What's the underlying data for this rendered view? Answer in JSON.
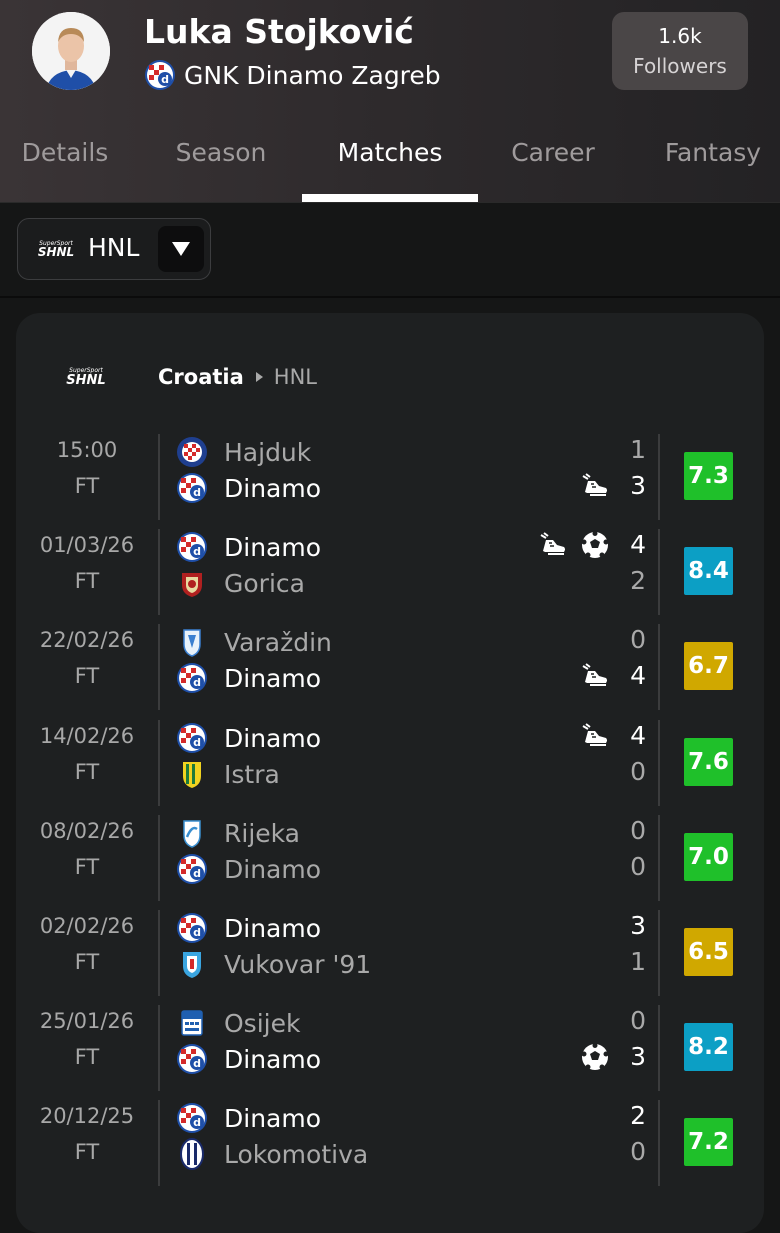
{
  "player": {
    "name": "Luka Stojković",
    "club": "GNK Dinamo Zagreb",
    "followers_count": "1.6k",
    "followers_label": "Followers"
  },
  "tabs": [
    {
      "label": "Details",
      "active": false
    },
    {
      "label": "Season",
      "active": false
    },
    {
      "label": "Matches",
      "active": true
    },
    {
      "label": "Career",
      "active": false
    },
    {
      "label": "Fantasy",
      "active": false
    }
  ],
  "league_select": {
    "label": "HNL",
    "logo_text": "SHNL",
    "logo_small": "SuperSport"
  },
  "breadcrumb": {
    "country": "Croatia",
    "league": "HNL"
  },
  "colors": {
    "rating_green": "#1fc02a",
    "rating_blue": "#0c9fc5",
    "rating_yellow": "#d0a800",
    "dinamo_blue": "#1f4fa8"
  },
  "matches": [
    {
      "date": "15:00",
      "status": "FT",
      "home": {
        "name": "Hajduk",
        "badge": "hajduk-badge",
        "score": "1",
        "dinamo": false,
        "events": []
      },
      "away": {
        "name": "Dinamo",
        "badge": "dinamo-badge",
        "score": "3",
        "dinamo": true,
        "events": [
          "assist-icon"
        ]
      },
      "rating": "7.3",
      "rating_color": "green"
    },
    {
      "date": "01/03/26",
      "status": "FT",
      "home": {
        "name": "Dinamo",
        "badge": "dinamo-badge",
        "score": "4",
        "dinamo": true,
        "events": [
          "assist-icon",
          "goal-icon"
        ]
      },
      "away": {
        "name": "Gorica",
        "badge": "gorica-badge",
        "score": "2",
        "dinamo": false,
        "events": []
      },
      "rating": "8.4",
      "rating_color": "blue"
    },
    {
      "date": "22/02/26",
      "status": "FT",
      "home": {
        "name": "Varaždin",
        "badge": "varazdin-badge",
        "score": "0",
        "dinamo": false,
        "events": []
      },
      "away": {
        "name": "Dinamo",
        "badge": "dinamo-badge",
        "score": "4",
        "dinamo": true,
        "events": [
          "assist-icon"
        ]
      },
      "rating": "6.7",
      "rating_color": "yellow"
    },
    {
      "date": "14/02/26",
      "status": "FT",
      "home": {
        "name": "Dinamo",
        "badge": "dinamo-badge",
        "score": "4",
        "dinamo": true,
        "events": [
          "assist-icon"
        ]
      },
      "away": {
        "name": "Istra",
        "badge": "istra-badge",
        "score": "0",
        "dinamo": false,
        "events": []
      },
      "rating": "7.6",
      "rating_color": "green"
    },
    {
      "date": "08/02/26",
      "status": "FT",
      "home": {
        "name": "Rijeka",
        "badge": "rijeka-badge",
        "score": "0",
        "dinamo": false,
        "events": []
      },
      "away": {
        "name": "Dinamo",
        "badge": "dinamo-badge",
        "score": "0",
        "dinamo": true,
        "events": []
      },
      "rating": "7.0",
      "rating_color": "green",
      "draw": true
    },
    {
      "date": "02/02/26",
      "status": "FT",
      "home": {
        "name": "Dinamo",
        "badge": "dinamo-badge",
        "score": "3",
        "dinamo": true,
        "events": []
      },
      "away": {
        "name": "Vukovar '91",
        "badge": "vukovar-badge",
        "score": "1",
        "dinamo": false,
        "events": []
      },
      "rating": "6.5",
      "rating_color": "yellow"
    },
    {
      "date": "25/01/26",
      "status": "FT",
      "home": {
        "name": "Osijek",
        "badge": "osijek-badge",
        "score": "0",
        "dinamo": false,
        "events": []
      },
      "away": {
        "name": "Dinamo",
        "badge": "dinamo-badge",
        "score": "3",
        "dinamo": true,
        "events": [
          "goal-icon"
        ]
      },
      "rating": "8.2",
      "rating_color": "blue"
    },
    {
      "date": "20/12/25",
      "status": "FT",
      "home": {
        "name": "Dinamo",
        "badge": "dinamo-badge",
        "score": "2",
        "dinamo": true,
        "events": []
      },
      "away": {
        "name": "Lokomotiva",
        "badge": "lokomotiva-badge",
        "score": "0",
        "dinamo": false,
        "events": []
      },
      "rating": "7.2",
      "rating_color": "green"
    }
  ]
}
